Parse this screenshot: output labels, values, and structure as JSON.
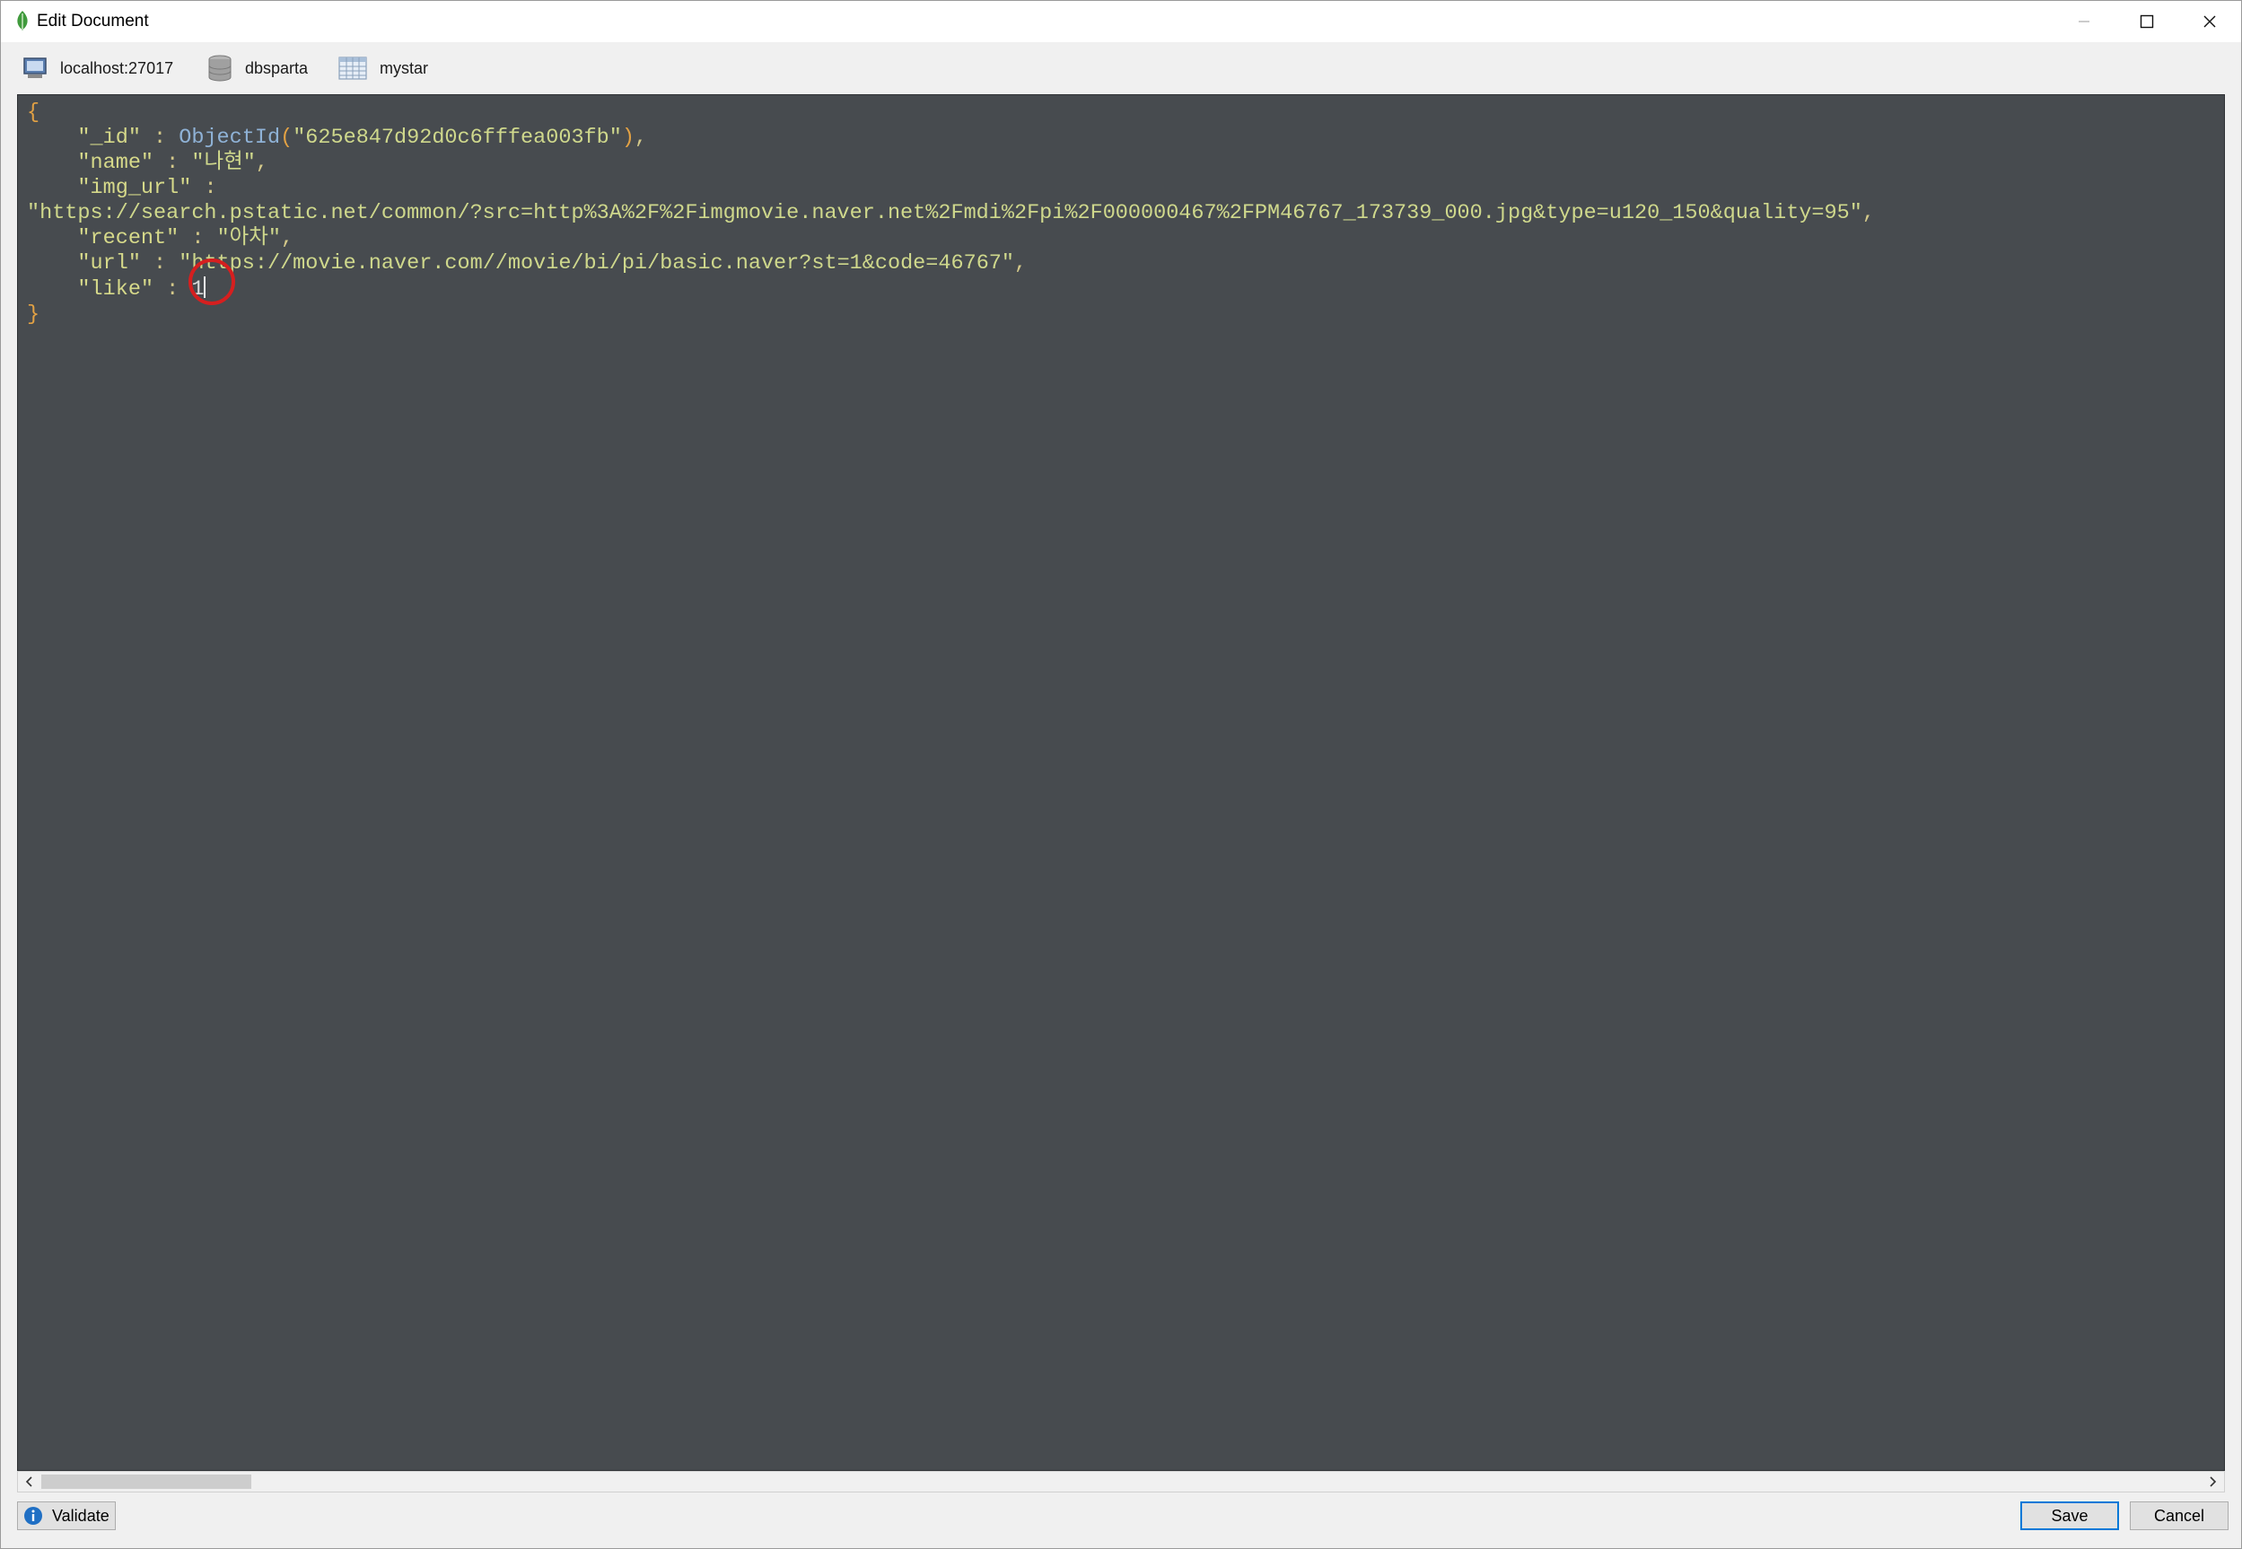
{
  "window": {
    "title": "Edit Document",
    "accent": "#0078d7"
  },
  "breadcrumb": {
    "server": "localhost:27017",
    "database": "dbsparta",
    "collection": "mystar"
  },
  "editor": {
    "background": "#474b4f",
    "lines": [
      "{",
      "    \"_id\" : ObjectId(\"625e847d92d0c6fffea003fb\"),",
      "    \"name\" : \"나현\",",
      "    \"img_url\" :",
      "\"https://search.pstatic.net/common/?src=http%3A%2F%2Fimgmovie.naver.net%2Fmdi%2Fpi%2F000000467%2FPM46767_173739_000.jpg&type=u120_150&quality=95\",",
      "    \"recent\" : \"아차\",",
      "    \"url\" : \"https://movie.naver.com//movie/bi/pi/basic.naver?st=1&code=46767\",",
      "    \"like\" : 1",
      "}"
    ],
    "document": {
      "id_key": "\"_id\"",
      "id_value": "\"625e847d92d0c6fffea003fb\"",
      "objectid_fn": "ObjectId",
      "name_key": "\"name\"",
      "name_value": "\"나현\"",
      "img_url_key": "\"img_url\"",
      "img_url_value": "\"https://search.pstatic.net/common/?src=http%3A%2F%2Fimgmovie.naver.net%2Fmdi%2Fpi%2F000000467%2FPM46767_173739_000.jpg&type=u120_150&quality=95\"",
      "recent_key": "\"recent\"",
      "recent_value": "\"아차\"",
      "url_key": "\"url\"",
      "url_value": "\"https://movie.naver.com//movie/bi/pi/basic.naver?st=1&code=46767\"",
      "like_key": "\"like\"",
      "like_value": "1"
    },
    "annotation_color": "#d61f1f"
  },
  "footer": {
    "validate_label": "Validate",
    "save_label": "Save",
    "cancel_label": "Cancel"
  },
  "icons": {
    "app": "leaf-icon",
    "server": "computer-icon",
    "database": "database-icon",
    "collection": "table-icon",
    "validate": "info-icon"
  }
}
